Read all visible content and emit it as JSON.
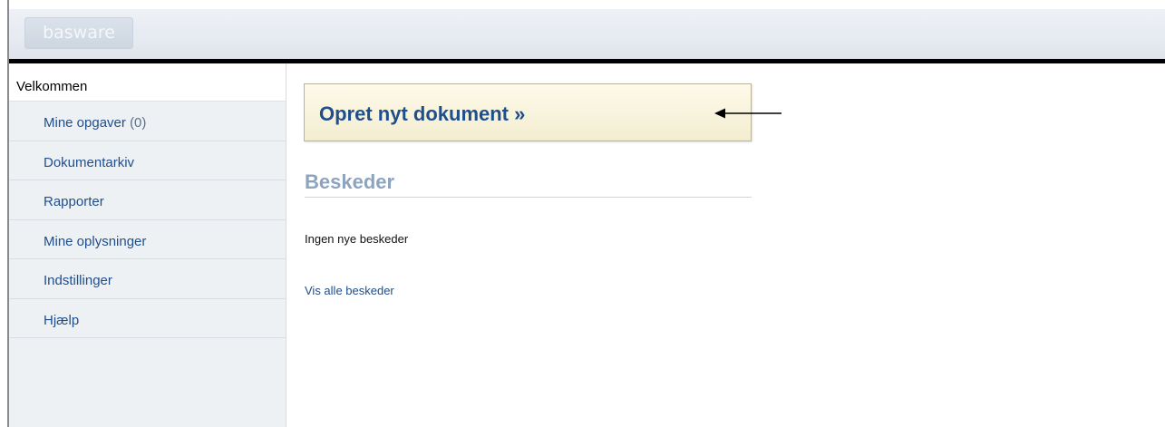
{
  "header": {
    "logo_text": "basware"
  },
  "sidebar": {
    "welcome": "Velkommen",
    "items": [
      {
        "label": "Mine opgaver",
        "count": "(0)"
      },
      {
        "label": "Dokumentarkiv"
      },
      {
        "label": "Rapporter"
      },
      {
        "label": "Mine oplysninger"
      },
      {
        "label": "Indstillinger"
      },
      {
        "label": "Hjælp"
      }
    ]
  },
  "main": {
    "create_button": "Opret nyt dokument »",
    "messages_title": "Beskeder",
    "no_messages": "Ingen nye beskeder",
    "view_all_link": "Vis alle beskeder"
  },
  "colors": {
    "link": "#1f4e8c",
    "section_title": "#8ea3bd",
    "header_bar": "#000000",
    "button_bg": "#f7f2dc"
  },
  "icons": {
    "annotation": "arrow-left-icon"
  }
}
